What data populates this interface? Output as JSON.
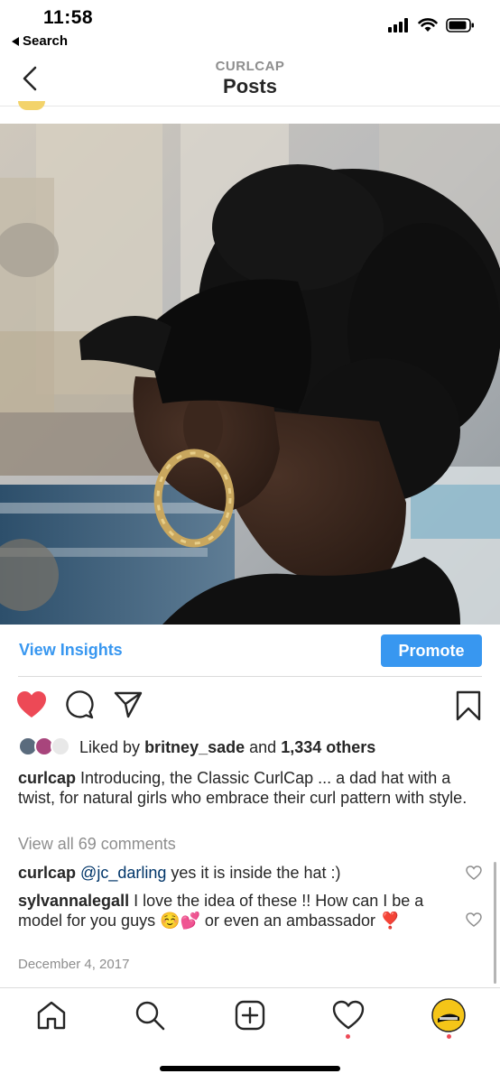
{
  "status_bar": {
    "time": "11:58",
    "back_app": "Search",
    "icons": [
      "cellular-signal-icon",
      "wifi-icon",
      "battery-icon"
    ]
  },
  "header": {
    "account": "CURLCAP",
    "title": "Posts",
    "back_icon": "chevron-left-icon"
  },
  "post": {
    "view_insights_label": "View Insights",
    "promote_label": "Promote",
    "actions": [
      "heart-filled-icon",
      "comment-icon",
      "share-icon",
      "bookmark-icon"
    ],
    "liked_by_prefix": "Liked by",
    "liked_by_user": "britney_sade",
    "liked_by_and": "and",
    "liked_by_others": "1,334 others",
    "caption_user": "curlcap",
    "caption_text": "Introducing, the Classic CurlCap ... a dad hat with a twist, for natural girls who embrace their curl pattern with style.",
    "view_all_comments": "View all 69 comments",
    "comments": [
      {
        "user": "curlcap",
        "mention": "@jc_darling",
        "text": "yes it is inside the hat :)"
      },
      {
        "user": "sylvannalegall",
        "text": "I love the idea of these !! How can I be a model for you guys ☺️💕 or even an ambassador ❣️"
      }
    ],
    "date": "December 4, 2017"
  },
  "colors": {
    "accent": "#3897f0",
    "like_red": "#ed4956",
    "secondary_text": "#8e8e8e"
  },
  "tab_bar": {
    "items": [
      "home-icon",
      "search-icon",
      "new-post-icon",
      "activity-heart-icon",
      "profile-avatar"
    ]
  }
}
